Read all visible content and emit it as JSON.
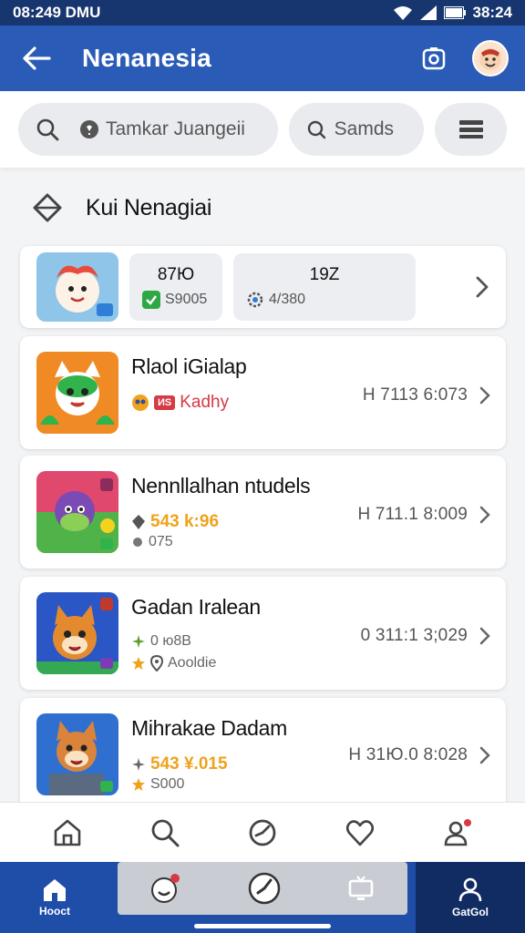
{
  "status_bar": {
    "time_left": "08:249 DMU",
    "time_right": "38:24"
  },
  "app_bar": {
    "title": "Nenanesia"
  },
  "search": {
    "query": "Tamkar Juangeii",
    "chip_label": "Samds"
  },
  "section": {
    "title": "Kui Nenagiai"
  },
  "summary": {
    "stat_a": {
      "value": "87Ю",
      "sub": "S9005"
    },
    "stat_b": {
      "value": "19Z",
      "sub": "4/380"
    }
  },
  "apps": [
    {
      "title": "Rlaol iGialap",
      "badge": "ИS",
      "meta1": "Kadhy",
      "meta2": "",
      "right": "H 7113 6:073",
      "art": "cat-green"
    },
    {
      "title": "Nennllalhan ntudels",
      "badge": "",
      "meta1": "543 k:96",
      "meta2": "075",
      "right": "H 711.1 8:009",
      "art": "purple-creature"
    },
    {
      "title": "Gadan Iralean",
      "badge": "",
      "meta1": "0 ю8B",
      "meta2": "Aooldie",
      "right": "0 311:1 3;029",
      "art": "fox-orange"
    },
    {
      "title": "Mihrakae Dadam",
      "badge": "",
      "meta1": "543 ¥.015",
      "meta2": "S000",
      "right": "H 31Ю.0 8:028",
      "art": "fox-blue"
    }
  ],
  "bottom_nav": {
    "home_label": "Hooct",
    "account_label": "GatGol"
  },
  "icons": {
    "back": "arrow-left-icon",
    "camera": "camera-icon",
    "search": "search-icon",
    "menu": "list-icon",
    "diamond": "diamond-icon",
    "chevron": "chevron-right-icon",
    "home": "home-icon",
    "heart": "heart-icon",
    "user": "user-icon"
  },
  "colors": {
    "primary": "#2a5bb7",
    "primary_dark": "#17366f",
    "accent_orange": "#f0a21a",
    "accent_red": "#d63a44"
  }
}
